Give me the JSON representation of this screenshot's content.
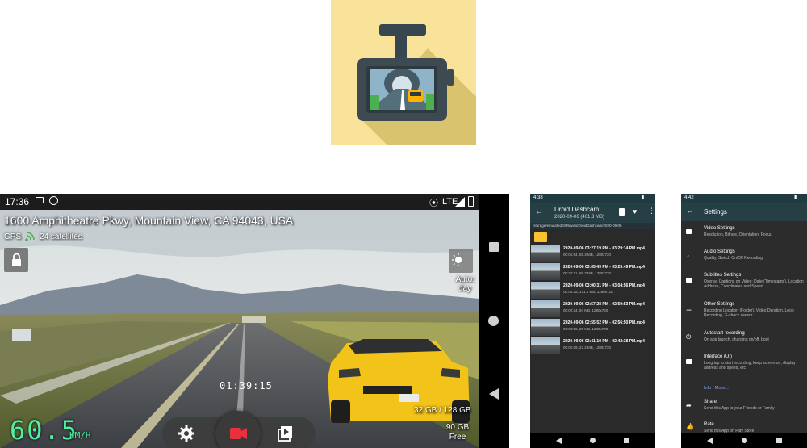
{
  "main": {
    "status": {
      "time": "17:36",
      "network": "LTE"
    },
    "address": "1600 Amphitheatre Pkwy, Mountain View, CA 94043, USA",
    "gps_label": "GPS",
    "satellites": "24 satellites",
    "mode_label": "Auto\nday",
    "mode_line1": "Auto:",
    "mode_line2": "day",
    "timer": "01:39:15",
    "storage_total": "32 GB / 128 GB",
    "storage_free_value": "90 GB",
    "storage_free_label": "Free",
    "speed": "60.5",
    "speed_unit": "KM/H",
    "icons": [
      "lock-icon",
      "settings-icon",
      "record-icon",
      "playback-icon",
      "day-night-icon"
    ],
    "record_color": "#e8313a"
  },
  "files": {
    "time": "4:38",
    "title": "Droid Dashcam",
    "subtitle": "2020-09-06 (461.3 MB)",
    "path": "/storage/emulated/0/Movies/DroidDashcam/2020-09-06",
    "folder_up": "..",
    "rows": [
      {
        "name": "2020-09-06 03:27:19 PM - 03:29:14 PM.mp4",
        "meta": "00:01:54, 55.3 MB, 1280x720"
      },
      {
        "name": "2020-09-06 03:05:49 PM - 03:25:49 PM.mp4",
        "meta": "00:20:21, 88.7 MB, 1280x720"
      },
      {
        "name": "2020-09-06 03:00:31 PM - 03:04:56 PM.mp4",
        "meta": "00:04:25, 171.1 MB, 1280x720"
      },
      {
        "name": "2020-09-06 02:57:28 PM - 02:59:53 PM.mp4",
        "meta": "00:02:24, 94 MB, 1280x720"
      },
      {
        "name": "2020-09-06 02:55:52 PM - 02:56:50 PM.mp4",
        "meta": "00:00:56, 25 MB, 1280x720"
      },
      {
        "name": "2020-09-06 02:41:10 PM - 02:42:38 PM.mp4",
        "meta": "00:01:09, 23.2 MB, 1280x720"
      }
    ]
  },
  "settings": {
    "time": "4:42",
    "title": "Settings",
    "items": [
      {
        "title": "Video Settings",
        "sub": "Resolution, Bitrate, Orientation, Focus"
      },
      {
        "title": "Audio Settings",
        "sub": "Quality, Switch On/Off Recording"
      },
      {
        "title": "Subtitles Settings",
        "sub": "Overlay Captions on Video: Date (Timestamp), Location Address, Coordinates and Speed"
      },
      {
        "title": "Other Settings",
        "sub": "Recording Location (Folder), Video Duration, Loop Recording, G-shock sensor"
      },
      {
        "title": "Autostart recording",
        "sub": "On app launch, charging on/off, boot"
      },
      {
        "title": "Interface (UI)",
        "sub": "Long tap to start recording, keep screen on, display address and speed, etc"
      }
    ],
    "link": "Info / More...",
    "share_title": "Share",
    "share_sub": "Send this App to your Friends or Family",
    "rate_title": "Rate",
    "rate_sub": "Send this App on Play Store"
  }
}
